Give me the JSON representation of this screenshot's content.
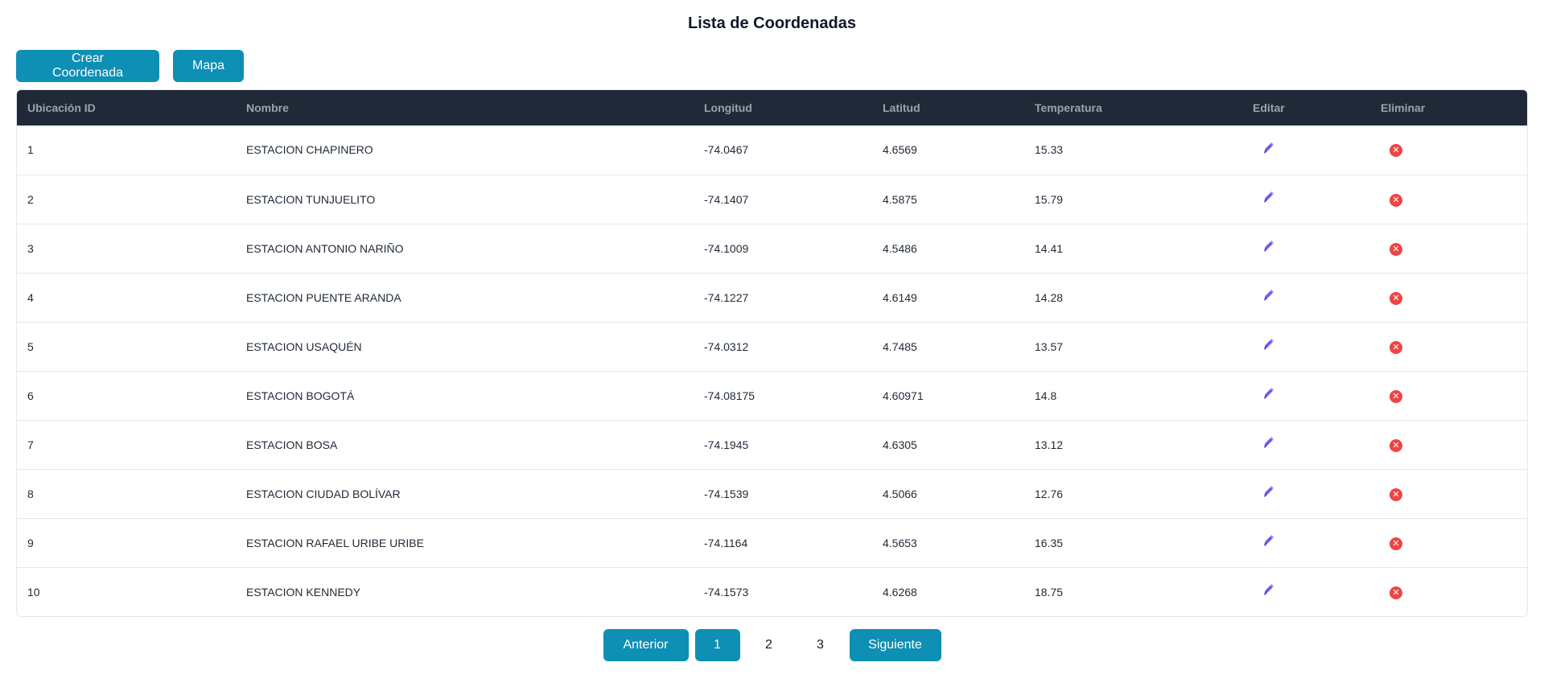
{
  "page": {
    "title": "Lista de Coordenadas"
  },
  "actions": {
    "create_label": "Crear Coordenada",
    "map_label": "Mapa"
  },
  "table": {
    "headers": [
      "Ubicación ID",
      "Nombre",
      "Longitud",
      "Latitud",
      "Temperatura",
      "Editar",
      "Eliminar"
    ],
    "rows": [
      {
        "id": "1",
        "nombre": "ESTACION CHAPINERO",
        "longitud": "-74.0467",
        "latitud": "4.6569",
        "temperatura": "15.33"
      },
      {
        "id": "2",
        "nombre": "ESTACION TUNJUELITO",
        "longitud": "-74.1407",
        "latitud": "4.5875",
        "temperatura": "15.79"
      },
      {
        "id": "3",
        "nombre": "ESTACION ANTONIO NARIÑO",
        "longitud": "-74.1009",
        "latitud": "4.5486",
        "temperatura": "14.41"
      },
      {
        "id": "4",
        "nombre": "ESTACION PUENTE ARANDA",
        "longitud": "-74.1227",
        "latitud": "4.6149",
        "temperatura": "14.28"
      },
      {
        "id": "5",
        "nombre": "ESTACION USAQUÉN",
        "longitud": "-74.0312",
        "latitud": "4.7485",
        "temperatura": "13.57"
      },
      {
        "id": "6",
        "nombre": "ESTACION BOGOTÁ",
        "longitud": "-74.08175",
        "latitud": "4.60971",
        "temperatura": "14.8"
      },
      {
        "id": "7",
        "nombre": "ESTACION BOSA",
        "longitud": "-74.1945",
        "latitud": "4.6305",
        "temperatura": "13.12"
      },
      {
        "id": "8",
        "nombre": "ESTACION CIUDAD BOLÍVAR",
        "longitud": "-74.1539",
        "latitud": "4.5066",
        "temperatura": "12.76"
      },
      {
        "id": "9",
        "nombre": "ESTACION RAFAEL URIBE URIBE",
        "longitud": "-74.1164",
        "latitud": "4.5653",
        "temperatura": "16.35"
      },
      {
        "id": "10",
        "nombre": "ESTACION KENNEDY",
        "longitud": "-74.1573",
        "latitud": "4.6268",
        "temperatura": "18.75"
      }
    ],
    "edit_icon": "pencil-icon",
    "delete_icon": "close-circle-icon"
  },
  "pagination": {
    "prev_label": "Anterior",
    "next_label": "Siguiente",
    "pages": [
      "1",
      "2",
      "3"
    ],
    "current_page": "1"
  },
  "colors": {
    "primary": "#0e8fb4",
    "header_bg": "#1f2937",
    "header_text": "#9ca3af",
    "edit_icon": "#6d5ce7",
    "delete_icon": "#ef4444"
  }
}
